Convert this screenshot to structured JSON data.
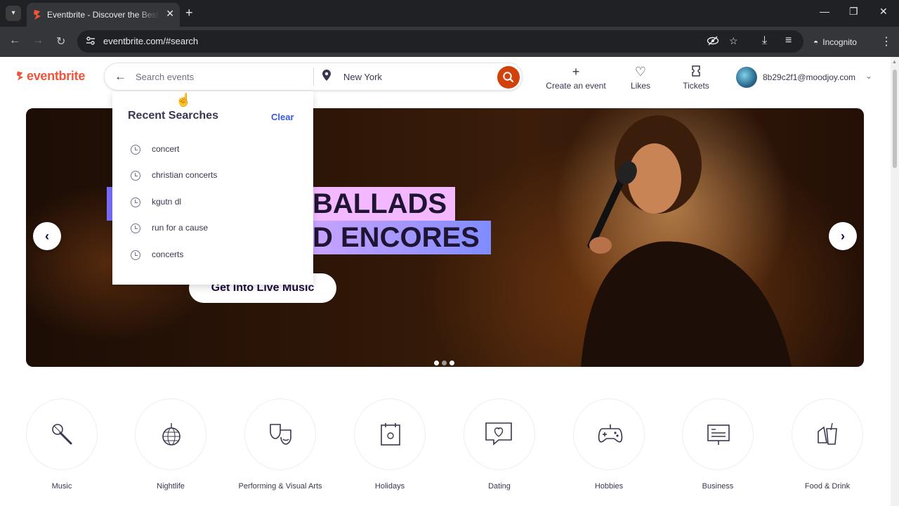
{
  "browser": {
    "tab_title": "Eventbrite - Discover the Best Local Events & Things to Do",
    "new_tab": "+",
    "url": "eventbrite.com/#search",
    "incognito_label": "Incognito",
    "window_minimize": "—",
    "window_restore": "❐",
    "window_close": "✕"
  },
  "header": {
    "logo": "eventbrite",
    "search": {
      "placeholder": "Search events",
      "value": ""
    },
    "location": "New York",
    "create_event": "Create an event",
    "likes": "Likes",
    "tickets": "Tickets",
    "user_email": "8b29c2f1@moodjoy.com"
  },
  "recent_searches": {
    "title": "Recent Searches",
    "clear": "Clear",
    "items": [
      "concert",
      "christian concerts",
      "kgutn dl",
      "run for a cause",
      "concerts"
    ]
  },
  "hero": {
    "line1": "BALLADS",
    "line2": "D ENCORES",
    "cta": "Get Into Live Music",
    "prev": "‹",
    "next": "›",
    "slide_count": 3,
    "active_slide": 1
  },
  "categories": [
    {
      "name": "Music",
      "icon": "microphone-icon"
    },
    {
      "name": "Nightlife",
      "icon": "disco-ball-icon"
    },
    {
      "name": "Performing & Visual Arts",
      "icon": "theater-masks-icon"
    },
    {
      "name": "Holidays",
      "icon": "calendar-sun-icon"
    },
    {
      "name": "Dating",
      "icon": "chat-heart-icon"
    },
    {
      "name": "Hobbies",
      "icon": "gamepad-icon"
    },
    {
      "name": "Business",
      "icon": "presentation-board-icon"
    },
    {
      "name": "Food & Drink",
      "icon": "drinks-icon"
    }
  ],
  "colors": {
    "brand": "#f05537",
    "search_button": "#d1410c",
    "link": "#3659e3",
    "text": "#39364f"
  }
}
